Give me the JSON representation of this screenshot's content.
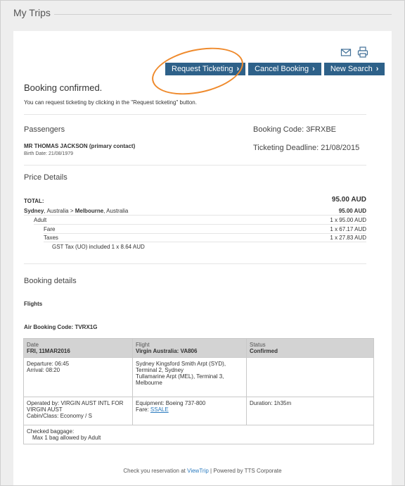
{
  "page": {
    "title": "My Trips"
  },
  "actions": {
    "request_ticketing": "Request Ticketing",
    "cancel_booking": "Cancel Booking",
    "new_search": "New Search"
  },
  "status": {
    "heading": "Booking confirmed.",
    "message": "You can request ticketing by clicking in the \"Request ticketing\" button."
  },
  "passengers": {
    "heading": "Passengers",
    "name": "MR THOMAS JACKSON (primary contact)",
    "birth_date": "Birth Date: 21/08/1979"
  },
  "booking": {
    "code_label": "Booking Code: 3FRXBE",
    "deadline_label": "Ticketing Deadline: 21/08/2015"
  },
  "price": {
    "heading": "Price Details",
    "total_label": "TOTAL:",
    "total_value": "95.00 AUD",
    "route_from": "Sydney",
    "route_from_country": ", Australia > ",
    "route_to": "Melbourne",
    "route_to_country": ", Australia",
    "route_value": "95.00 AUD",
    "adult_label": "Adult",
    "adult_value": "1 x 95.00 AUD",
    "fare_label": "Fare",
    "fare_value": "1 x 67.17 AUD",
    "taxes_label": "Taxes",
    "taxes_value": "1 x 27.83 AUD",
    "gst_label": "GST Tax (UO) included 1 x 8.64 AUD"
  },
  "details": {
    "heading": "Booking details",
    "flights_heading": "Flights",
    "air_code": "Air Booking Code: TVRX1G"
  },
  "flight_table": {
    "col_date": "Date",
    "date": "FRI, 11MAR2016",
    "col_flight": "Flight",
    "flight": "Virgin Australia: VA806",
    "col_status": "Status",
    "status": "Confirmed",
    "departure": "Departure: 06:45",
    "arrival": "Arrival: 08:20",
    "from_airport": "Sydney Kingsford Smith Arpt (SYD), Terminal 2, Sydney",
    "to_airport": "Tullamarine Arpt (MEL), Terminal 3, Melbourne",
    "operated_by": "Operated by: VIRGIN AUST INTL FOR VIRGIN AUST",
    "cabin": "Cabin/Class: Economy / S",
    "equipment": "Equipment: Boeing 737-800",
    "fare_label": "Fare: ",
    "fare_code": "SSALE",
    "duration": "Duration: 1h35m",
    "baggage_label": "Checked baggage:",
    "baggage_value": "Max 1 bag allowed by Adult"
  },
  "footer": {
    "pre": "Check you reservation at ",
    "link": "ViewTrip",
    "post": " | Powered by TTS Corporate"
  },
  "colors": {
    "button": "#2e6189",
    "highlight": "#ef8a2c",
    "link": "#2b7bbf"
  },
  "icons": [
    "envelope-icon",
    "printer-icon",
    "chevron-right-icon"
  ]
}
